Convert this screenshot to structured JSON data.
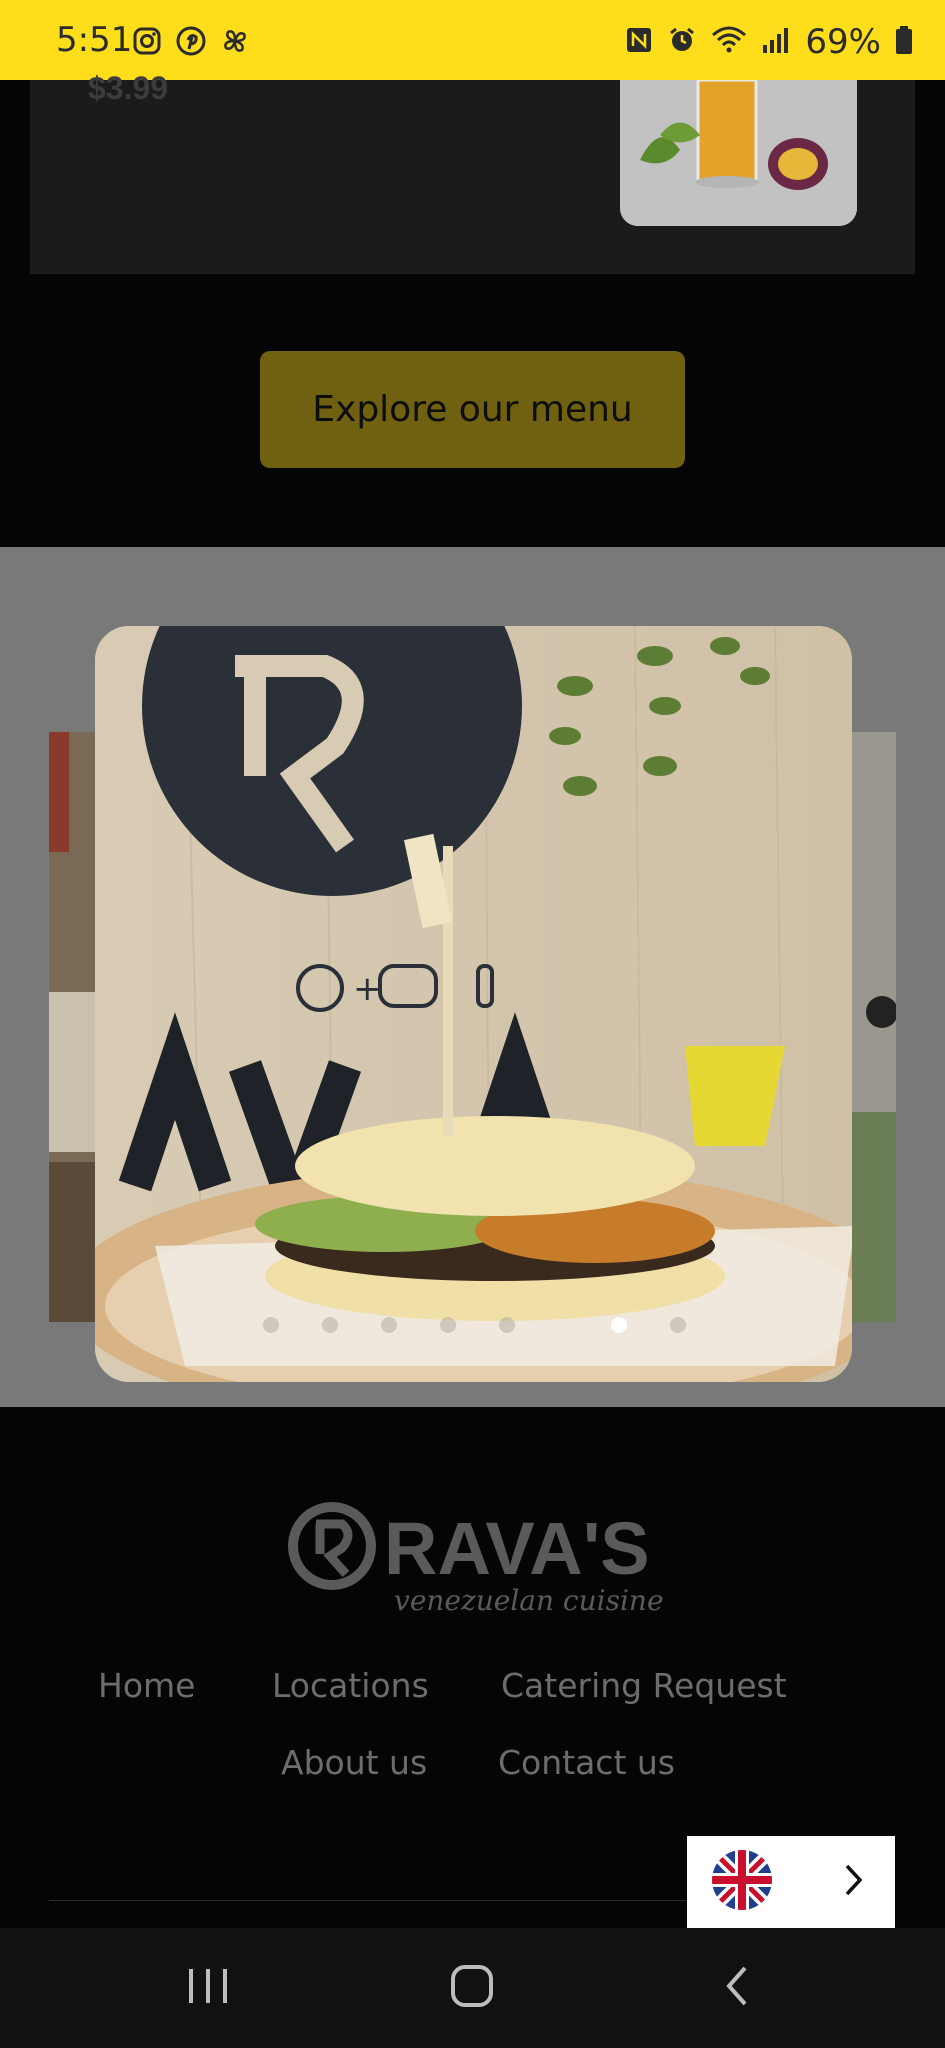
{
  "status_bar": {
    "time": "5:51",
    "battery_percent": "69%",
    "left_icons": [
      "instagram-icon",
      "pinterest-icon",
      "pinwheel-icon"
    ],
    "right_icons": [
      "nfc-icon",
      "alarm-icon",
      "wifi-icon",
      "signal-icon",
      "battery-icon"
    ],
    "bg_color": "#fedd1b"
  },
  "menu_item": {
    "price": "$3.99"
  },
  "cta": {
    "explore_label": "Explore our menu",
    "color": "#6f6110"
  },
  "carousel": {
    "slide_count": 7,
    "active_index": 5
  },
  "footer": {
    "logo_name": "RAVA'S",
    "logo_tagline": "venezuelan cuisine",
    "nav": {
      "home": "Home",
      "locations": "Locations",
      "catering": "Catering Request",
      "about": "About us",
      "contact": "Contact us"
    }
  },
  "language_widget": {
    "flag": "uk-flag-icon",
    "chevron": "chevron-right-icon"
  },
  "system_nav": {
    "buttons": [
      "recents-icon",
      "home-icon",
      "back-icon"
    ]
  }
}
